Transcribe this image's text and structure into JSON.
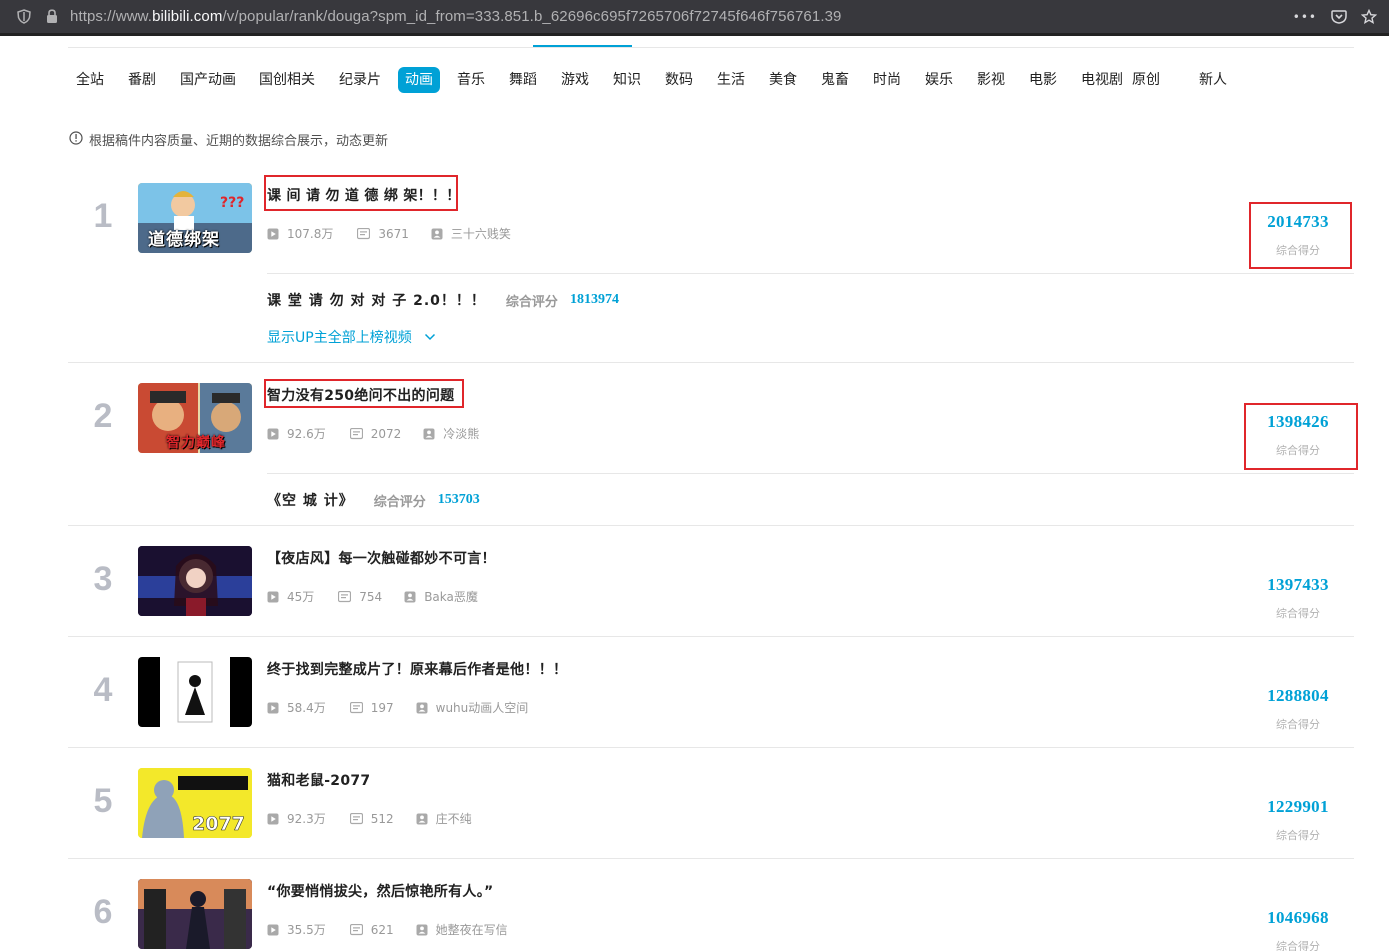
{
  "browser": {
    "url_prefix": "https://www.",
    "url_domain": "bilibili.com",
    "url_rest": "/v/popular/rank/douga?spm_id_from=333.851.b_62696c695f7265706f72745f646f756761.39",
    "more_label": "•••"
  },
  "categories": [
    "全站",
    "番剧",
    "国产动画",
    "国创相关",
    "纪录片",
    "动画",
    "音乐",
    "舞蹈",
    "游戏",
    "知识",
    "数码",
    "生活",
    "美食",
    "鬼畜",
    "时尚",
    "娱乐",
    "影视",
    "电影",
    "电视剧",
    "原创",
    "新人"
  ],
  "active_category": "动画",
  "notice": "根据稿件内容质量、近期的数据综合展示，动态更新",
  "score_label": "综合得分",
  "sub_score_label": "综合评分",
  "more_videos_label": "显示UP主全部上榜视频",
  "items": [
    {
      "rank": "1",
      "title": "课 间 请 勿 道 德 绑 架！！！",
      "plays": "107.8万",
      "danmaku": "3671",
      "author": "三十六贱笑",
      "score": "2014733",
      "thumb_text": "道德绑架",
      "thumb_bg": "#e9b949",
      "extra": {
        "title": "课 堂 请 勿 对 对 子 2.0！！！",
        "score": "1813974"
      }
    },
    {
      "rank": "2",
      "title": "智力没有250绝问不出的问题",
      "plays": "92.6万",
      "danmaku": "2072",
      "author": "冷淡熊",
      "score": "1398426",
      "thumb_text": "智力巅峰",
      "thumb_bg": "#c8b68a",
      "extra": {
        "title": "《空 城 计》",
        "score": "153703"
      }
    },
    {
      "rank": "3",
      "title": "【夜店风】每一次触碰都妙不可言！",
      "plays": "45万",
      "danmaku": "754",
      "author": "Baka恶魔",
      "score": "1397433",
      "thumb_text": "",
      "thumb_bg": "#2a1a3a"
    },
    {
      "rank": "4",
      "title": "终于找到完整成片了！原来幕后作者是他！！！",
      "plays": "58.4万",
      "danmaku": "197",
      "author": "wuhu动画人空间",
      "score": "1288804",
      "thumb_text": "",
      "thumb_bg": "#ffffff"
    },
    {
      "rank": "5",
      "title": "猫和老鼠-2077",
      "plays": "92.3万",
      "danmaku": "512",
      "author": "庄不纯",
      "score": "1229901",
      "thumb_text": "2077",
      "thumb_bg": "#f3e82a"
    },
    {
      "rank": "6",
      "title": "“你要悄悄拔尖，然后惊艳所有人。”",
      "plays": "35.5万",
      "danmaku": "621",
      "author": "她整夜在写信",
      "score": "1046968",
      "thumb_text": "",
      "thumb_bg": "#3a2a4a"
    }
  ],
  "colors": {
    "accent": "#00a1d6",
    "highlight": "#e0262b",
    "rank_gray": "#b9bcc5"
  }
}
